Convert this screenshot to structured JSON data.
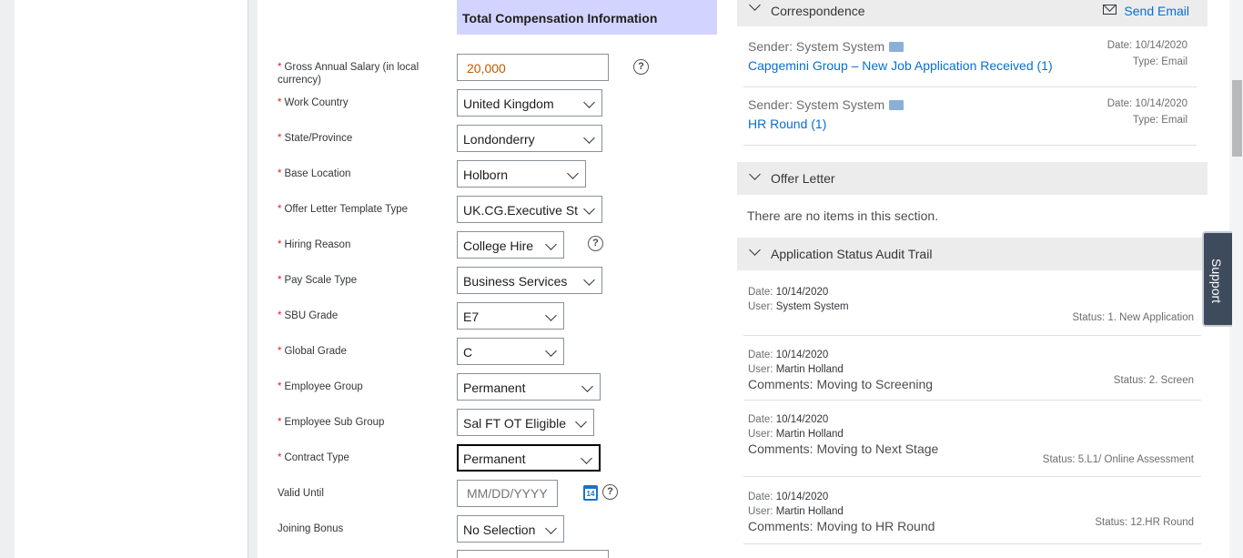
{
  "form": {
    "section_title": "Total Compensation Information",
    "fields": [
      {
        "label": "Gross Annual Salary (in local currency)",
        "value": "20,000",
        "required": true
      },
      {
        "label": "Work Country",
        "value": "United Kingdom",
        "required": true
      },
      {
        "label": "State/Province",
        "value": "Londonderry",
        "required": true
      },
      {
        "label": "Base Location",
        "value": "Holborn",
        "required": true
      },
      {
        "label": "Offer Letter Template Type",
        "value": "UK.CG.Executive St",
        "required": true
      },
      {
        "label": "Hiring Reason",
        "value": "College Hire",
        "required": true
      },
      {
        "label": "Pay Scale Type",
        "value": "Business Services",
        "required": true
      },
      {
        "label": "SBU Grade",
        "value": "E7",
        "required": true
      },
      {
        "label": "Global Grade",
        "value": "C",
        "required": true
      },
      {
        "label": "Employee Group",
        "value": "Permanent",
        "required": true
      },
      {
        "label": "Employee Sub Group",
        "value": "Sal FT OT Eligible",
        "required": true
      },
      {
        "label": "Contract Type",
        "value": "Permanent",
        "required": true
      },
      {
        "label": "Valid Until",
        "placeholder": "MM/DD/YYYY",
        "required": false
      },
      {
        "label": "Joining Bonus",
        "value": "No Selection",
        "required": false
      }
    ],
    "required_mark": "*",
    "help_glyph": "?",
    "calendar_glyph": "14"
  },
  "correspondence": {
    "title": "Correspondence",
    "send_email": "Send Email",
    "items": [
      {
        "sender": "Sender: System System",
        "link": "Capgemini Group – New Job Application Received (1)",
        "date": "Date: 10/14/2020",
        "type": "Type: Email"
      },
      {
        "sender": "Sender: System System",
        "link": "HR Round (1)",
        "date": "Date: 10/14/2020",
        "type": "Type: Email"
      }
    ]
  },
  "offer_letter": {
    "title": "Offer Letter",
    "empty": "There are no items in this section."
  },
  "audit": {
    "title": "Application Status Audit Trail",
    "date_label": "Date:",
    "user_label": "User:",
    "items": [
      {
        "date": "10/14/2020",
        "user": "System System",
        "comment": "",
        "status": "Status: 1. New Application"
      },
      {
        "date": "10/14/2020",
        "user": "Martin Holland",
        "comment": "Comments: Moving to Screening",
        "status": "Status: 2. Screen"
      },
      {
        "date": "10/14/2020",
        "user": "Martin Holland",
        "comment": "Comments: Moving to Next Stage",
        "status": "Status: 5.L1/ Online Assessment"
      },
      {
        "date": "10/14/2020",
        "user": "Martin Holland",
        "comment": "Comments: Moving to HR Round",
        "status": "Status: 12.HR Round"
      }
    ]
  },
  "support": {
    "label": "Support"
  },
  "colors": {
    "accent": "#0a6ed1",
    "required": "#d9262c",
    "section_header": "#d3d3ff",
    "support_tab": "#3d4b5c"
  }
}
